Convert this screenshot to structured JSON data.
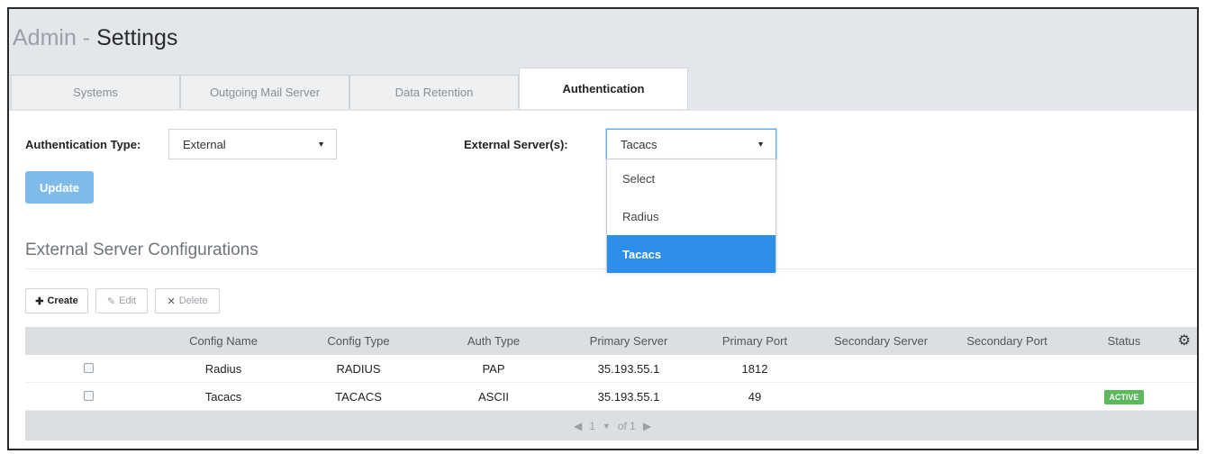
{
  "header": {
    "title_prefix": "Admin - ",
    "title_main": "Settings"
  },
  "tabs": [
    {
      "label": "Systems"
    },
    {
      "label": "Outgoing Mail Server"
    },
    {
      "label": "Data Retention"
    },
    {
      "label": "Authentication",
      "active": true
    }
  ],
  "auth_form": {
    "auth_type_label": "Authentication Type:",
    "auth_type_value": "External",
    "external_server_label": "External Server(s):",
    "external_server_value": "Tacacs",
    "update_label": "Update"
  },
  "dropdown": {
    "options": [
      "Select",
      "Radius",
      "Tacacs"
    ],
    "selected": "Tacacs"
  },
  "section": {
    "title": "External Server Configurations"
  },
  "toolbar": {
    "create_label": "Create",
    "edit_label": "Edit",
    "delete_label": "Delete"
  },
  "table": {
    "columns": [
      "Config Name",
      "Config Type",
      "Auth Type",
      "Primary Server",
      "Primary Port",
      "Secondary Server",
      "Secondary Port",
      "Status"
    ],
    "rows": [
      {
        "config_name": "Radius",
        "config_type": "RADIUS",
        "auth_type": "PAP",
        "primary_server": "35.193.55.1",
        "primary_port": "1812",
        "secondary_server": "",
        "secondary_port": "",
        "status": ""
      },
      {
        "config_name": "Tacacs",
        "config_type": "TACACS",
        "auth_type": "ASCII",
        "primary_server": "35.193.55.1",
        "primary_port": "49",
        "secondary_server": "",
        "secondary_port": "",
        "status": "ACTIVE"
      }
    ]
  },
  "pagination": {
    "page": "1",
    "of_label": "of 1"
  },
  "colors": {
    "accent": "#2d8fea",
    "update_button": "#7fbbe9",
    "active_badge": "#5cb85c",
    "header_bg": "#e3e6ea"
  },
  "icons": {
    "create": "plus-icon",
    "edit": "pencil-icon",
    "delete": "close-icon",
    "settings": "gear-icon",
    "prev": "caret-left-icon",
    "next": "caret-right-icon",
    "select_arrow": "caret-down-icon"
  }
}
